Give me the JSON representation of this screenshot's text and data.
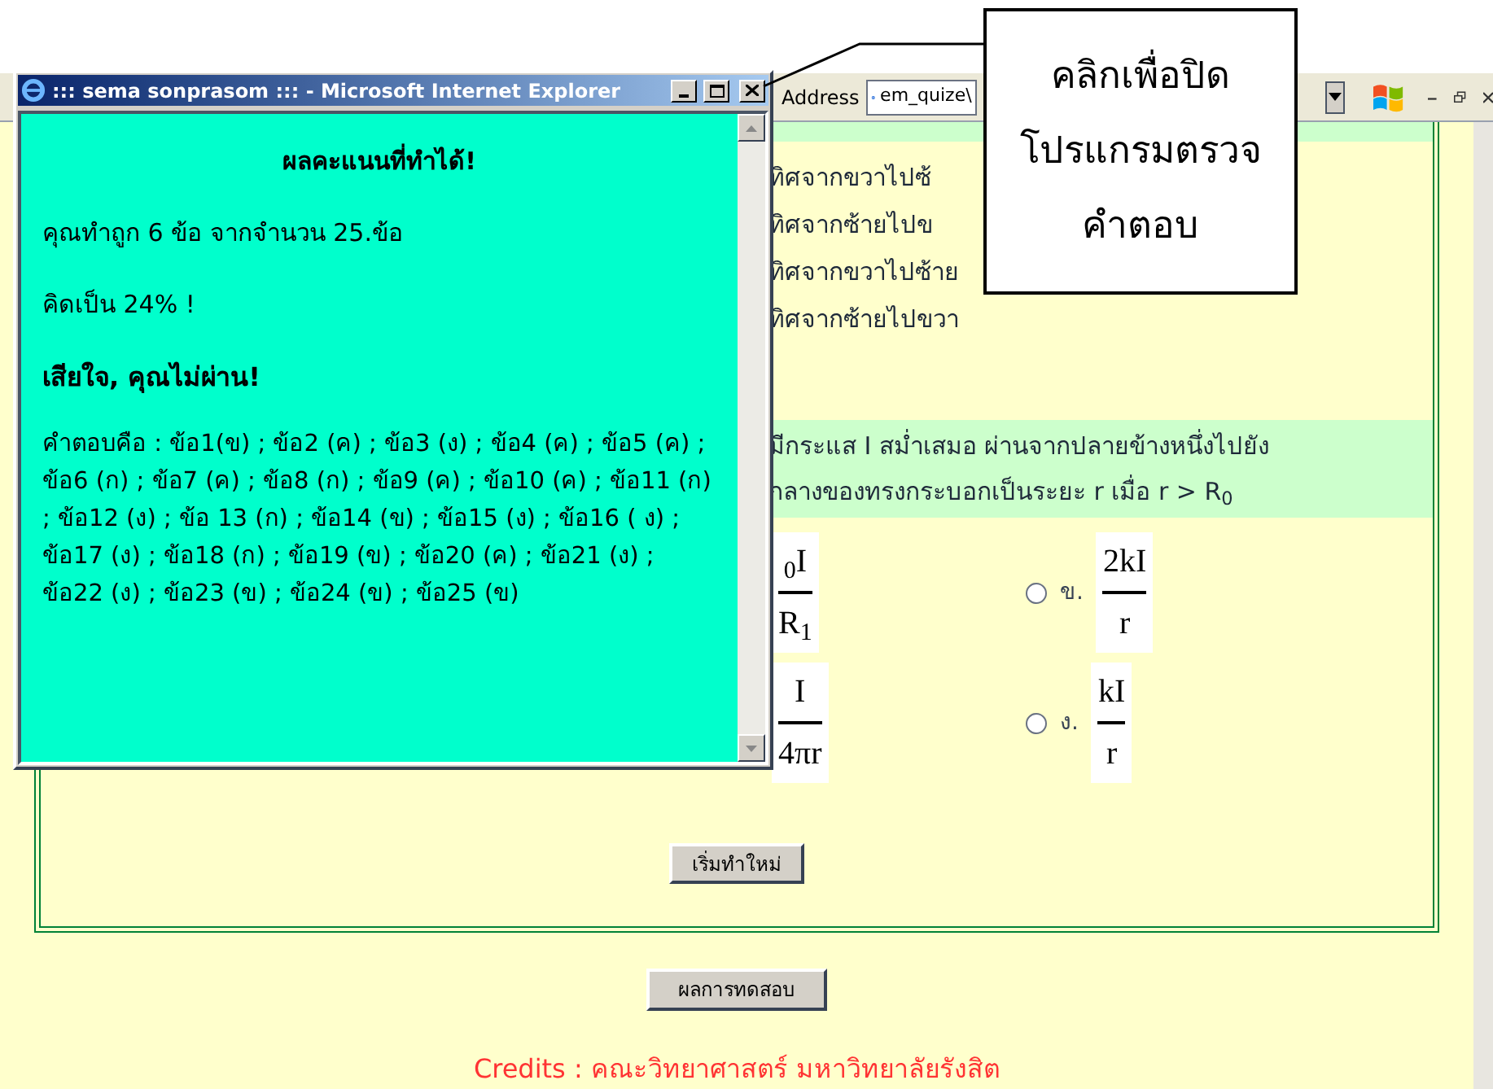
{
  "browser": {
    "address_label": "Address",
    "address_value": "em_quize\\"
  },
  "question_1": {
    "options": [
      "ทิศจากขวาไปซ้",
      "ทิศจากซ้ายไปข",
      "ทิศจากขวาไปซ้าย",
      "ทิศจากซ้ายไปขวา"
    ]
  },
  "question_2": {
    "text_lines": [
      "มีกระแส I สม่ำเสมอ ผ่านจากปลายข้างหนึ่งไปยัง",
      "กลางของทรงกระบอกเป็นระยะ r เมื่อ r > R$_{0}$"
    ],
    "options": [
      {
        "kind": "partial",
        "numerator": "$_{0}$I",
        "denominator": "R$_{1}$"
      },
      {
        "kind": "radio",
        "label": "ข.",
        "selected": false,
        "numerator": "2kI",
        "denominator": "r"
      },
      {
        "kind": "partial",
        "numerator": "I",
        "denominator": "4πr"
      },
      {
        "kind": "radio",
        "label": "ง.",
        "selected": false,
        "numerator": "kI",
        "denominator": "r"
      }
    ]
  },
  "buttons": {
    "restart": "เริ่มทำใหม่",
    "results": "ผลการทดสอบ"
  },
  "credits": "Credits : คณะวิทยาศาสตร์ มหาวิทยาลัยรังสิต",
  "popup": {
    "title": "::: sema sonprasom ::: - Microsoft Internet Explorer",
    "heading": "ผลคะแนนที่ทำได้!",
    "score_line": "คุณทำถูก 6 ข้อ จากจำนวน 25.ข้อ",
    "percent_line": "คิดเป็น 24% !",
    "verdict": "เสียใจ, คุณไม่ผ่าน!",
    "answers": "คำตอบคือ : ข้อ1(ข) ; ข้อ2 (ค) ; ข้อ3 (ง) ; ข้อ4 (ค) ; ข้อ5 (ค) ; ข้อ6 (ก) ; ข้อ7 (ค) ; ข้อ8 (ก) ; ข้อ9 (ค) ; ข้อ10 (ค) ; ข้อ11 (ก) ; ข้อ12 (ง) ; ข้อ 13 (ก) ; ข้อ14 (ข) ; ข้อ15 (ง) ; ข้อ16 ( ง) ; ข้อ17 (ง) ; ข้อ18 (ก) ; ข้อ19 (ข) ; ข้อ20 (ค) ; ข้อ21 (ง) ; ข้อ22 (ง) ; ข้อ23 (ข) ; ข้อ24 (ข) ; ข้อ25 (ข)"
  },
  "callout": {
    "lines": [
      "คลิกเพื่อปิด",
      "โปรแกรมตรวจ",
      "คำตอบ"
    ]
  }
}
